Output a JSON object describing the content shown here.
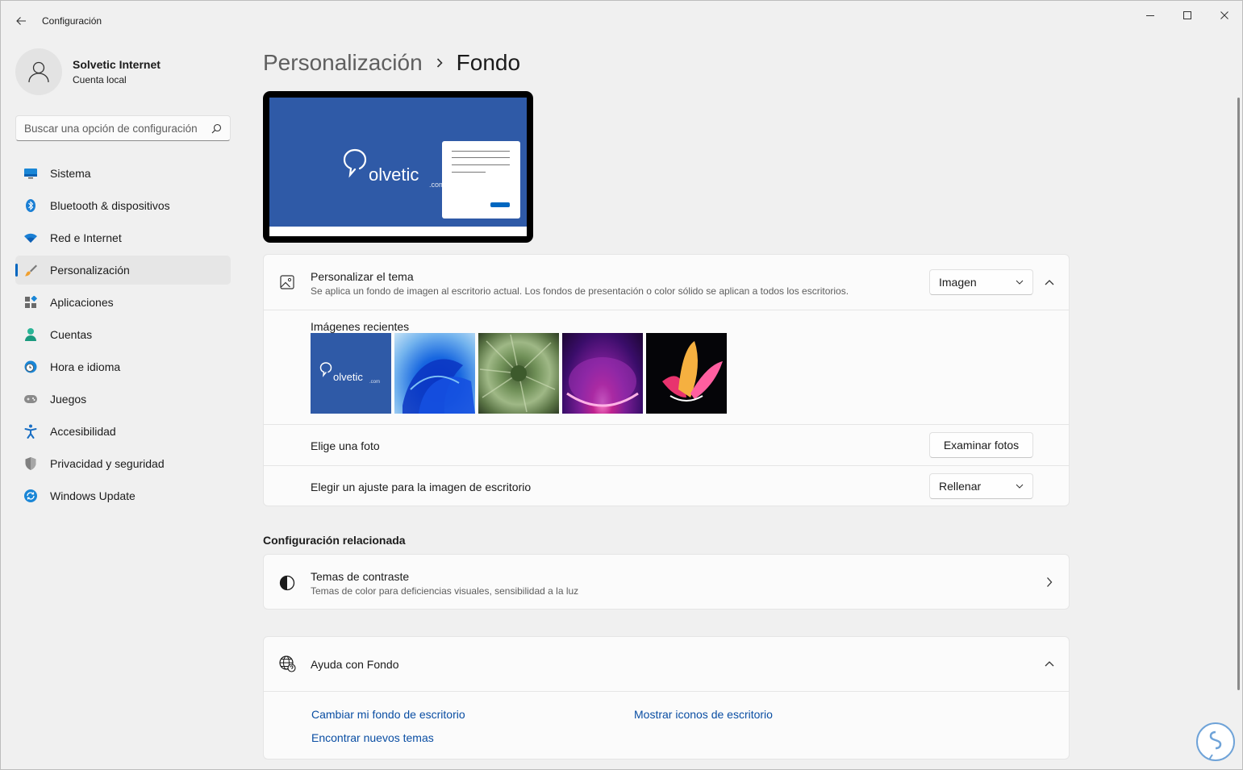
{
  "app": {
    "title": "Configuración"
  },
  "profile": {
    "name": "Solvetic Internet",
    "account_type": "Cuenta local"
  },
  "search": {
    "placeholder": "Buscar una opción de configuración"
  },
  "sidebar": {
    "items": [
      {
        "label": "Sistema",
        "icon": "monitor-icon",
        "active": false
      },
      {
        "label": "Bluetooth & dispositivos",
        "icon": "bluetooth-icon",
        "active": false
      },
      {
        "label": "Red e Internet",
        "icon": "wifi-icon",
        "active": false
      },
      {
        "label": "Personalización",
        "icon": "brush-icon",
        "active": true
      },
      {
        "label": "Aplicaciones",
        "icon": "apps-icon",
        "active": false
      },
      {
        "label": "Cuentas",
        "icon": "person-icon",
        "active": false
      },
      {
        "label": "Hora e idioma",
        "icon": "clock-globe-icon",
        "active": false
      },
      {
        "label": "Juegos",
        "icon": "gamepad-icon",
        "active": false
      },
      {
        "label": "Accesibilidad",
        "icon": "accessibility-icon",
        "active": false
      },
      {
        "label": "Privacidad y seguridad",
        "icon": "shield-icon",
        "active": false
      },
      {
        "label": "Windows Update",
        "icon": "update-icon",
        "active": false
      }
    ]
  },
  "breadcrumb": {
    "parent": "Personalización",
    "current": "Fondo"
  },
  "preview": {
    "logo_text": "olvetic",
    "logo_suffix": ".com"
  },
  "background_card": {
    "theme_row": {
      "title": "Personalizar el tema",
      "description": "Se aplica un fondo de imagen al escritorio actual. Los fondos de presentación o color sólido se aplican a todos los escritorios.",
      "dropdown_value": "Imagen",
      "expanded": true
    },
    "recent": {
      "label": "Imágenes recientes",
      "images": [
        {
          "name": "solvetic-wallpaper",
          "caption": "olvetic",
          "caption_suffix": ".com"
        },
        {
          "name": "windows-bloom-blue"
        },
        {
          "name": "succulent-spiral"
        },
        {
          "name": "purple-glow"
        },
        {
          "name": "abstract-flower-dark"
        }
      ]
    },
    "photo_row": {
      "title": "Elige una foto",
      "button": "Examinar fotos"
    },
    "fit_row": {
      "title": "Elegir un ajuste para la imagen de escritorio",
      "dropdown_value": "Rellenar"
    }
  },
  "related": {
    "section_title": "Configuración relacionada",
    "contrast": {
      "title": "Temas de contraste",
      "description": "Temas de color para deficiencias visuales, sensibilidad a la luz"
    }
  },
  "help": {
    "title": "Ayuda con Fondo",
    "links": [
      "Cambiar mi fondo de escritorio",
      "Mostrar iconos de escritorio",
      "Encontrar nuevos temas"
    ]
  },
  "colors": {
    "accent": "#0067c0",
    "link": "#0a4ea3",
    "preview_bg": "#2f5aa7"
  }
}
